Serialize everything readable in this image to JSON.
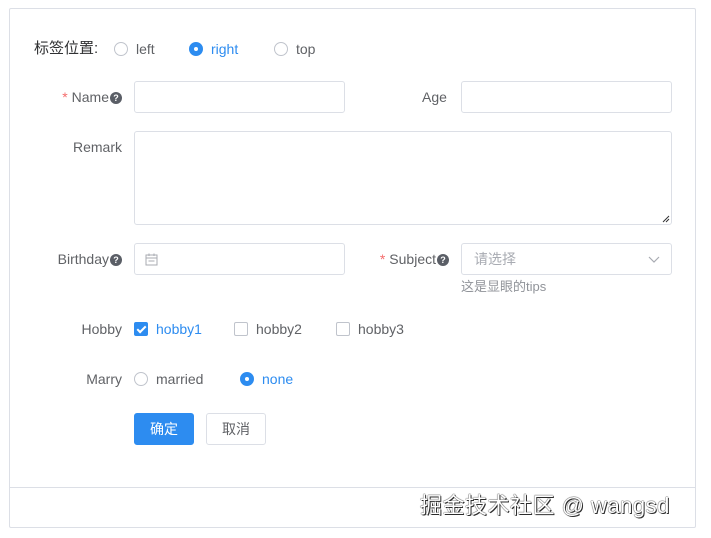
{
  "label_position": {
    "label": "标签位置:",
    "options": [
      "left",
      "right",
      "top"
    ],
    "selected": "right"
  },
  "fields": {
    "name_label": "Name",
    "age_label": "Age",
    "remark_label": "Remark",
    "birthday_label": "Birthday",
    "subject_label": "Subject",
    "subject_placeholder": "请选择",
    "subject_tip": "这是显眼的tips",
    "hobby_label": "Hobby",
    "hobbies": [
      "hobby1",
      "hobby2",
      "hobby3"
    ],
    "hobbies_checked": [
      "hobby1"
    ],
    "marry_label": "Marry",
    "marry_options": [
      "married",
      "none"
    ],
    "marry_selected": "none"
  },
  "buttons": {
    "confirm": "确定",
    "cancel": "取消"
  },
  "watermark": "掘金技术社区 @ wangsd",
  "colors": {
    "primary": "#2d8cf0",
    "required": "#f56c6c",
    "border": "#dcdfe6",
    "text": "#606266"
  }
}
